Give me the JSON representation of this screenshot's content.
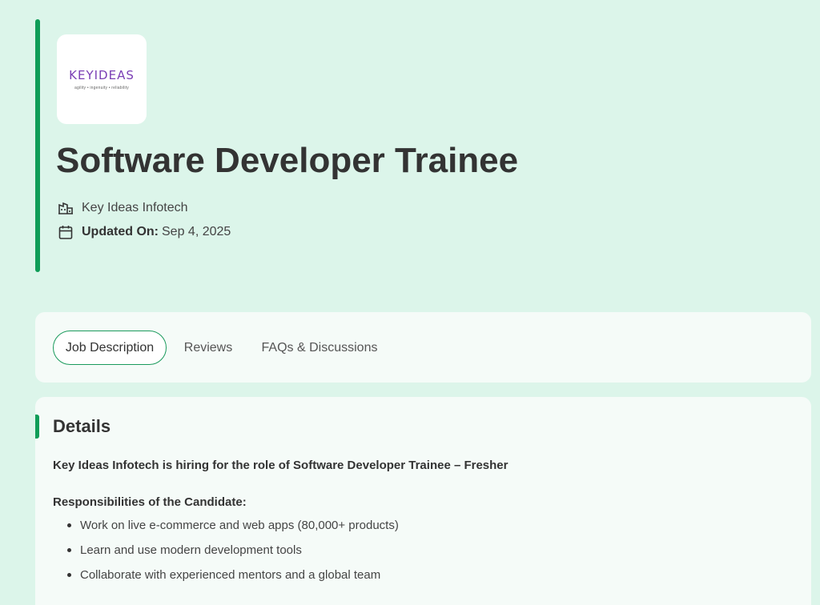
{
  "company": {
    "logo_word": "KEYIDEAS",
    "logo_tagline": "agility • ingenuity • reliability",
    "name": "Key Ideas Infotech"
  },
  "job": {
    "title": "Software Developer Trainee",
    "updated_label": "Updated On:",
    "updated_value": "Sep 4, 2025"
  },
  "tabs": [
    {
      "label": "Job Description",
      "active": true
    },
    {
      "label": "Reviews",
      "active": false
    },
    {
      "label": "FAQs & Discussions",
      "active": false
    }
  ],
  "details": {
    "heading": "Details",
    "intro": "Key Ideas Infotech is hiring for the role of Software Developer Trainee – Fresher",
    "responsibilities_heading": "Responsibilities of the Candidate:",
    "responsibilities": [
      "Work on live e-commerce and web apps (80,000+ products)",
      "Learn and use modern development tools",
      "Collaborate with experienced mentors and a global team"
    ]
  },
  "colors": {
    "background": "#dcf5ea",
    "accent": "#0f9d58",
    "card": "#f5fbf8",
    "logo": "#7b3fb5"
  },
  "icons": [
    "company-building-icon",
    "calendar-icon"
  ]
}
